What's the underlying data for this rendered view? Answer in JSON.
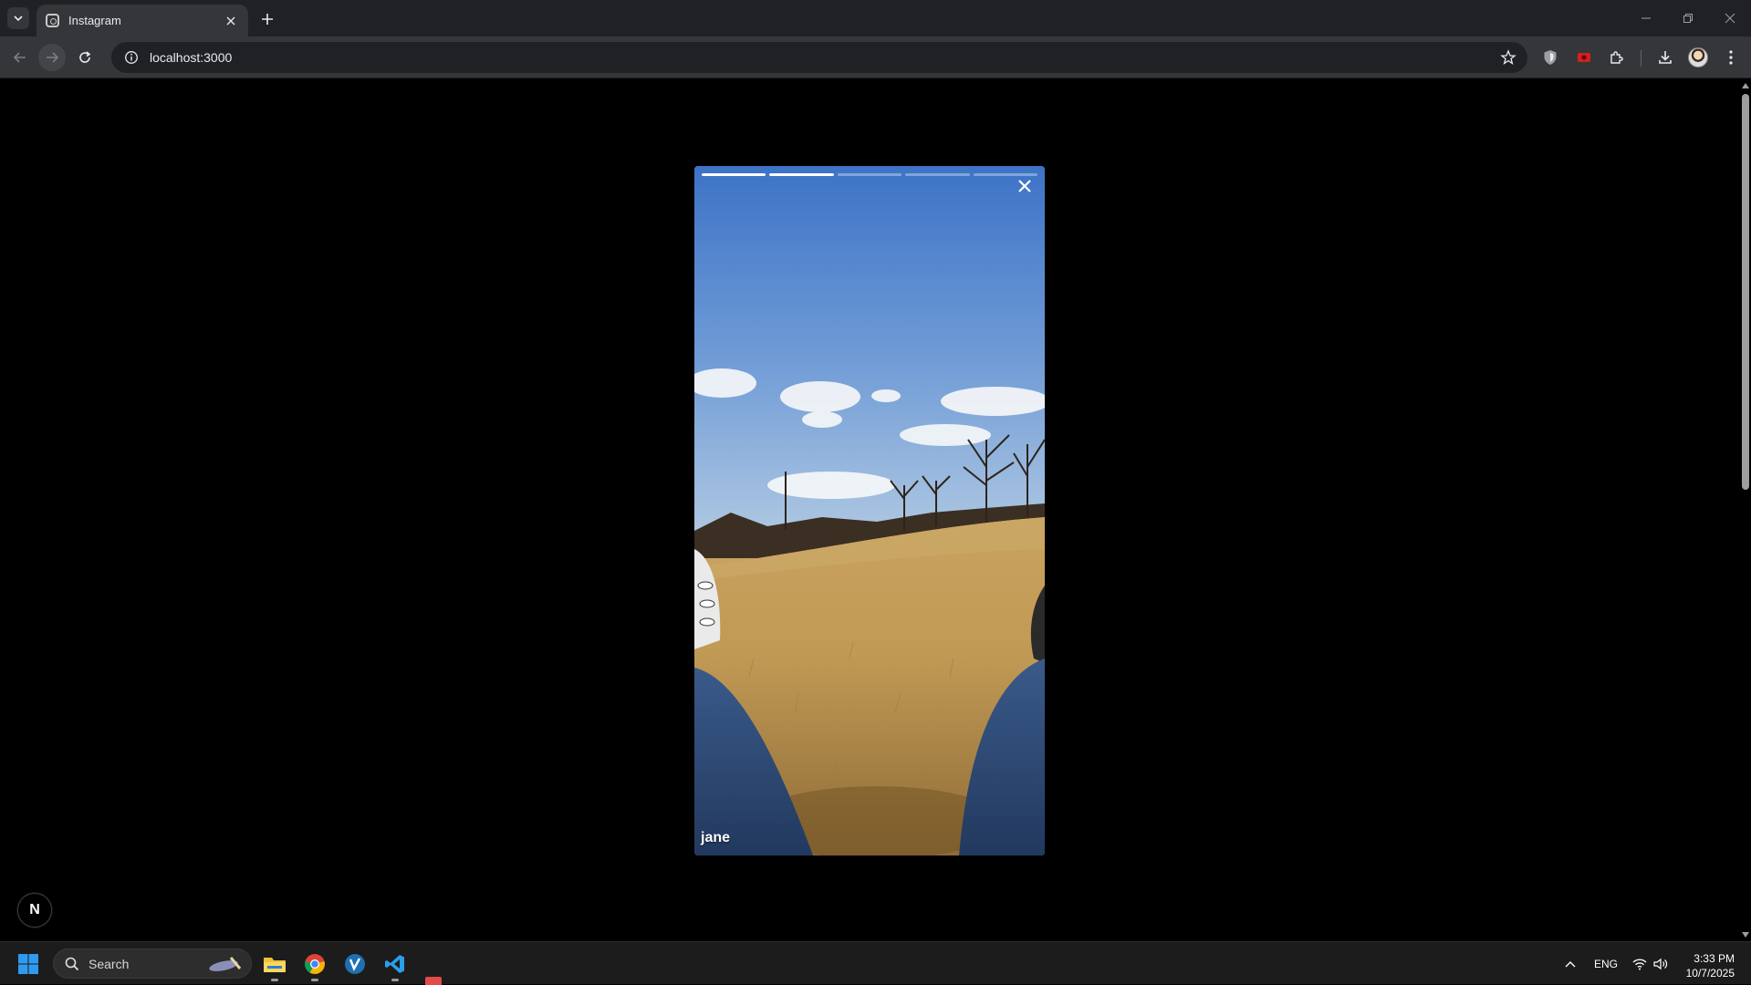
{
  "browser": {
    "tab_title": "Instagram",
    "url": "localhost:3000"
  },
  "story": {
    "username": "jane",
    "segments": [
      {
        "progress": 1.0
      },
      {
        "progress": 1.0
      },
      {
        "progress": 0.0
      },
      {
        "progress": 0.0
      },
      {
        "progress": 0.0
      }
    ],
    "active_segment_index": 1
  },
  "dev_badge": {
    "letter": "N"
  },
  "taskbar": {
    "search_placeholder": "Search",
    "language": "ENG",
    "time": "3:33 PM",
    "date": "10/7/2025"
  }
}
